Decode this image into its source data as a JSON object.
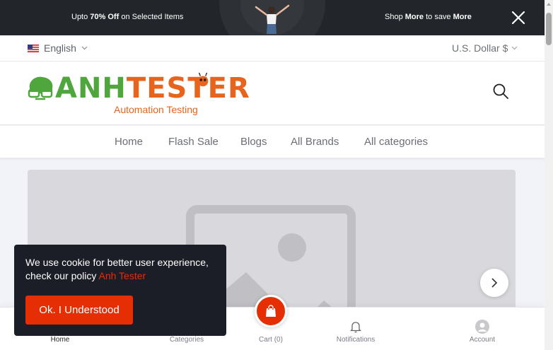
{
  "promo": {
    "left_prefix": "Upto ",
    "left_bold": "70% Off",
    "left_suffix": " on Selected Items",
    "right_prefix": "Shop ",
    "right_bold1": "More",
    "right_mid": " to save ",
    "right_bold2": "More"
  },
  "language": {
    "label": "English",
    "flag": "us-flag-icon"
  },
  "currency": {
    "label": "U.S. Dollar $"
  },
  "logo": {
    "part1": "ANH",
    "part2": "TESTER",
    "subtitle": "Automation Testing"
  },
  "nav": {
    "items": [
      "Home",
      "Flash Sale",
      "Blogs",
      "All Brands",
      "All categories"
    ]
  },
  "cookie": {
    "text": "We use cookie for better user experience, check our policy ",
    "link": "Anh Tester",
    "button": "Ok. I Understood"
  },
  "bottom_nav": {
    "home": "Home",
    "categories": "Categories",
    "cart": "Cart (0)",
    "notifications": "Notifications",
    "account": "Account"
  },
  "colors": {
    "accent": "#e62e04",
    "logo_green": "#4fa63d",
    "logo_orange": "#e8641c",
    "topbar": "#222529"
  }
}
